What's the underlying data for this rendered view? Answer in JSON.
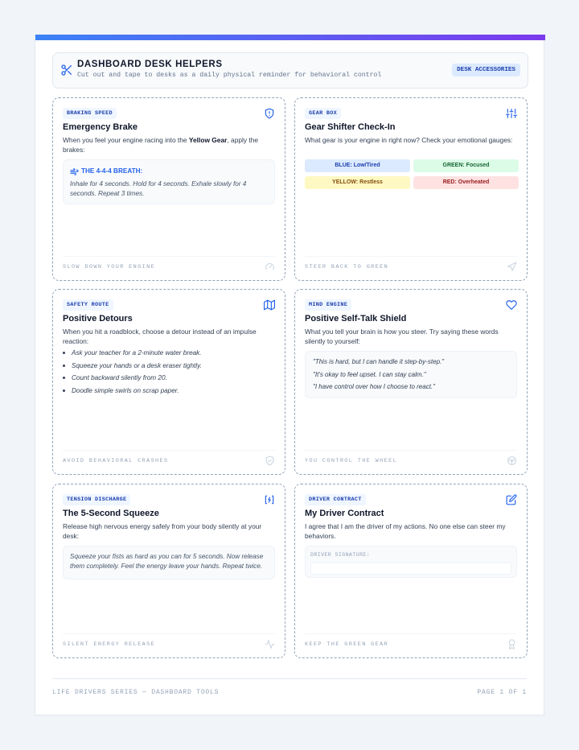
{
  "header": {
    "title": "DASHBOARD DESK HELPERS",
    "subtitle": "Cut out and tape to desks as a daily physical reminder for behavioral control",
    "badge": "DESK ACCESSORIES",
    "icon": "scissors-icon"
  },
  "cards": {
    "brake": {
      "badge": "BRAKING SPEED",
      "icon": "shield-icon",
      "title": "Emergency Brake",
      "desc_before": "When you feel your engine racing into the ",
      "desc_bold": "Yellow Gear",
      "desc_after": ", apply the brakes:",
      "box_title": "THE 4-4-4 BREATH:",
      "box_icon": "wind-icon",
      "box_text": "Inhale for 4 seconds. Hold for 4 seconds. Exhale slowly for 4 seconds. Repeat 3 times.",
      "footer": "SLOW DOWN YOUR ENGINE",
      "footer_icon": "gauge-icon"
    },
    "gear": {
      "badge": "GEAR BOX",
      "icon": "sliders-icon",
      "title": "Gear Shifter Check-In",
      "desc": "What gear is your engine in right now? Check your emotional gauges:",
      "gauges": [
        {
          "label": "BLUE: Low/Tired",
          "bg": "#dbeafe",
          "fg": "#1e40af"
        },
        {
          "label": "GREEN: Focused",
          "bg": "#dcfce7",
          "fg": "#166534"
        },
        {
          "label": "YELLOW: Restless",
          "bg": "#fef9c3",
          "fg": "#854d0e"
        },
        {
          "label": "RED: Overheated",
          "bg": "#fee2e2",
          "fg": "#991b1b"
        }
      ],
      "footer": "STEER BACK TO GREEN",
      "footer_icon": "navigation-icon"
    },
    "detours": {
      "badge": "SAFETY ROUTE",
      "icon": "map-icon",
      "title": "Positive Detours",
      "desc": "When you hit a roadblock, choose a detour instead of an impulse reaction:",
      "items": [
        "Ask your teacher for a 2-minute water break.",
        "Squeeze your hands or a desk eraser tightly.",
        "Count backward silently from 20.",
        "Doodle simple swirls on scrap paper."
      ],
      "footer": "AVOID BEHAVIORAL CRASHES",
      "footer_icon": "shield-check-icon"
    },
    "selftalk": {
      "badge": "MIND ENGINE",
      "icon": "heart-icon",
      "title": "Positive Self-Talk Shield",
      "desc": "What you tell your brain is how you steer. Try saying these words silently to yourself:",
      "quotes": [
        "\"This is hard, but I can handle it step-by-step.\"",
        "\"It's okay to feel upset. I can stay calm.\"",
        "\"I have control over how I choose to react.\""
      ],
      "footer": "YOU CONTROL THE WHEEL",
      "footer_icon": "steering-wheel-icon"
    },
    "squeeze": {
      "badge": "TENSION DISCHARGE",
      "icon": "code-brackets-icon",
      "title": "The 5-Second Squeeze",
      "desc": "Release high nervous energy safely from your body silently at your desk:",
      "box_text": "Squeeze your fists as hard as you can for 5 seconds. Now release them completely. Feel the energy leave your hands. Repeat twice.",
      "footer": "SILENT ENERGY RELEASE",
      "footer_icon": "activity-icon"
    },
    "contract": {
      "badge": "DRIVER CONTRACT",
      "icon": "edit-icon",
      "title": "My Driver Contract",
      "desc": "I agree that I am the driver of my actions. No one else can steer my behaviors.",
      "sig_label": "DRIVER SIGNATURE:",
      "sig_value": "",
      "footer": "KEEP THE GREEN GEAR",
      "footer_icon": "award-icon"
    }
  },
  "page_footer": {
    "left": "LIFE DRIVERS SERIES — DASHBOARD TOOLS",
    "right": "PAGE 1 OF 1"
  },
  "colors": {
    "accent": "#2563eb",
    "gradient_start": "#3b82f6",
    "gradient_end": "#7c3aed"
  }
}
